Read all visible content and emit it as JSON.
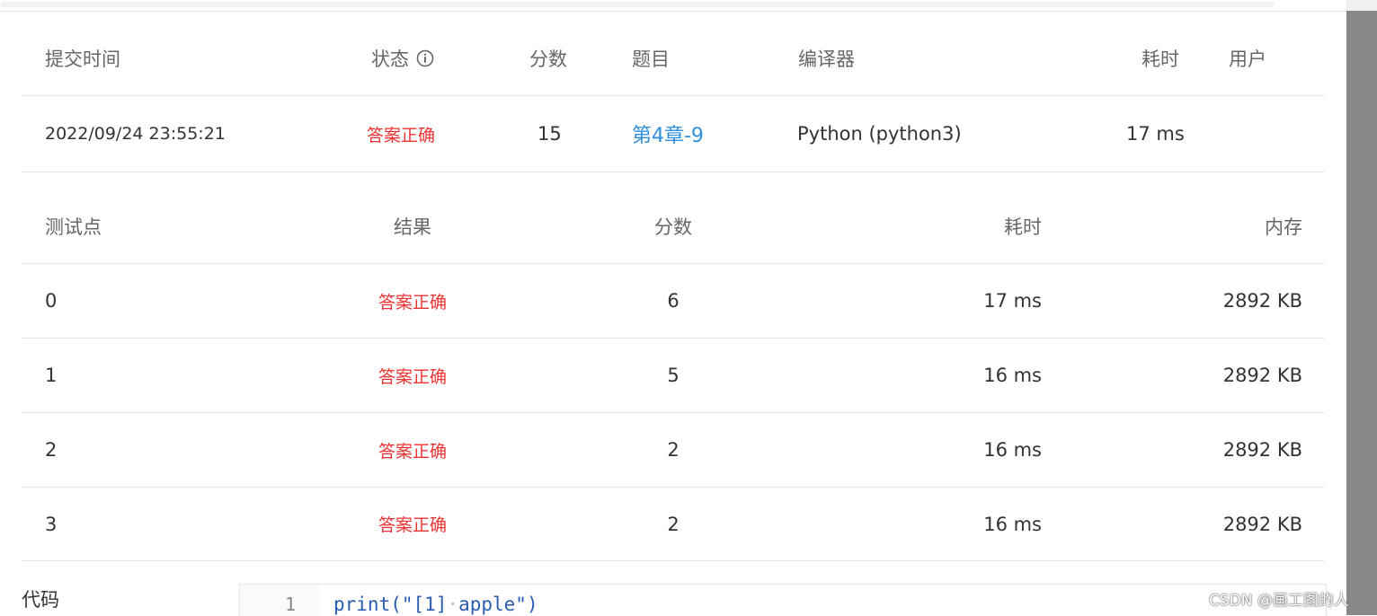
{
  "submission": {
    "headers": {
      "time": "提交时间",
      "status": "状态",
      "score": "分数",
      "problem": "题目",
      "compiler": "编译器",
      "duration": "耗时",
      "user": "用户"
    },
    "row": {
      "time": "2022/09/24 23:55:21",
      "status": "答案正确",
      "score": "15",
      "problem": "第4章-9",
      "compiler": "Python (python3)",
      "duration": "17 ms",
      "user": ""
    }
  },
  "testcases": {
    "headers": {
      "point": "测试点",
      "result": "结果",
      "score": "分数",
      "duration": "耗时",
      "memory": "内存"
    },
    "rows": [
      {
        "point": "0",
        "result": "答案正确",
        "score": "6",
        "duration": "17 ms",
        "memory": "2892 KB"
      },
      {
        "point": "1",
        "result": "答案正确",
        "score": "5",
        "duration": "16 ms",
        "memory": "2892 KB"
      },
      {
        "point": "2",
        "result": "答案正确",
        "score": "2",
        "duration": "16 ms",
        "memory": "2892 KB"
      },
      {
        "point": "3",
        "result": "答案正确",
        "score": "2",
        "duration": "16 ms",
        "memory": "2892 KB"
      }
    ]
  },
  "code": {
    "label": "代码",
    "line_number": "1",
    "tokens": {
      "func": "print",
      "open": "(\"[1]",
      "space": "·",
      "rest": "apple\")"
    }
  },
  "watermark": "CSDN @画工图的人",
  "colors": {
    "accepted": "#ee3333",
    "link": "#2e8fdc",
    "header_text": "#666666"
  },
  "icons": {
    "status_info": "info-circle-icon"
  }
}
